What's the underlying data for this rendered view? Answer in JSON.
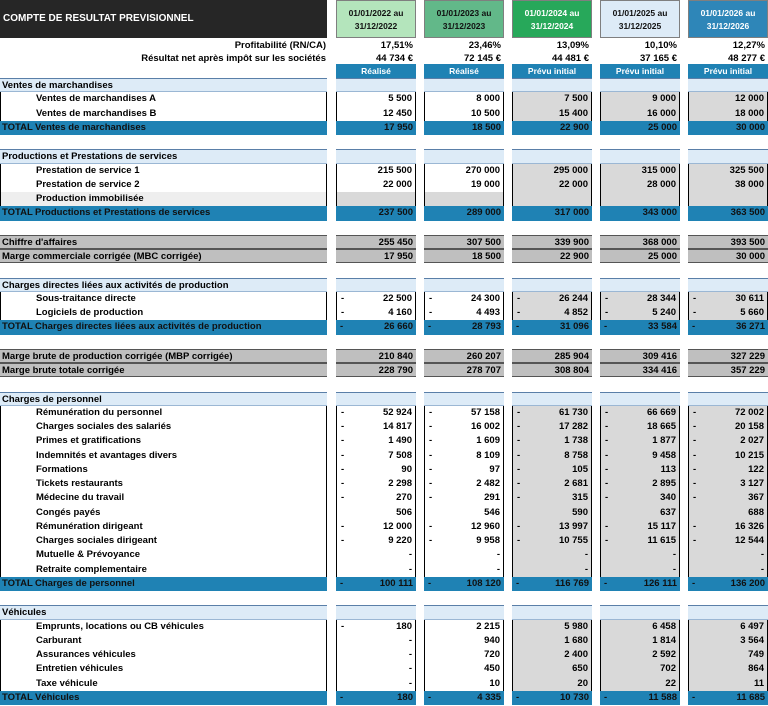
{
  "title": "COMPTE DE RESULTAT PREVISIONNEL",
  "periods": [
    {
      "line1": "01/01/2022 au",
      "line2": "31/12/2022",
      "color": "#b4e5bc",
      "status": "Réalisé"
    },
    {
      "line1": "01/01/2023 au",
      "line2": "31/12/2023",
      "color": "#62b889",
      "status": "Réalisé"
    },
    {
      "line1": "01/01/2024 au",
      "line2": "31/12/2024",
      "color": "#27a85a",
      "status": "Prévu initial"
    },
    {
      "line1": "01/01/2025 au",
      "line2": "31/12/2025",
      "color": "#ddebf7",
      "status": "Prévu initial"
    },
    {
      "line1": "01/01/2026 au",
      "line2": "31/12/2026",
      "color": "#2e86b8",
      "status": "Prévu initial"
    }
  ],
  "kpis": [
    {
      "label": "Profitabilité (RN/CA)",
      "values": [
        "17,51%",
        "23,46%",
        "13,09%",
        "10,10%",
        "12,27%"
      ]
    },
    {
      "label": "Résultat net après impôt sur les sociétés",
      "values": [
        "44 734 €",
        "72 145 €",
        "44 481 €",
        "37 165 €",
        "48 277 €"
      ]
    }
  ],
  "rows": [
    {
      "type": "section",
      "label": "Ventes de marchandises"
    },
    {
      "type": "item",
      "label": "Ventes de marchandises A",
      "values": [
        "5 500",
        "8 000",
        "7 500",
        "9 000",
        "12 000"
      ]
    },
    {
      "type": "item",
      "label": "Ventes de marchandises B",
      "values": [
        "12 450",
        "10 500",
        "15 400",
        "16 000",
        "18 000"
      ]
    },
    {
      "type": "total",
      "prefix": "TOTAL",
      "label": "Ventes de marchandises",
      "values": [
        "17 950",
        "18 500",
        "22 900",
        "25 000",
        "30 000"
      ]
    },
    {
      "type": "gap"
    },
    {
      "type": "section",
      "label": "Productions et Prestations de services"
    },
    {
      "type": "item",
      "label": "Prestation de service 1",
      "values": [
        "215 500",
        "270 000",
        "295 000",
        "315 000",
        "325 500"
      ]
    },
    {
      "type": "item",
      "label": "Prestation de service 2",
      "values": [
        "22 000",
        "19 000",
        "22 000",
        "28 000",
        "38 000"
      ]
    },
    {
      "type": "item",
      "label": "Production immobilisée",
      "values": [
        "",
        "",
        "",
        "",
        ""
      ],
      "shade": true
    },
    {
      "type": "total",
      "prefix": "TOTAL",
      "label": "Productions et Prestations de services",
      "values": [
        "237 500",
        "289 000",
        "317 000",
        "343 000",
        "363 500"
      ]
    },
    {
      "type": "gap"
    },
    {
      "type": "grey",
      "label": "Chiffre d'affaires",
      "values": [
        "255 450",
        "307 500",
        "339 900",
        "368 000",
        "393 500"
      ]
    },
    {
      "type": "grey",
      "label": "Marge commerciale corrigée (MBC corrigée)",
      "values": [
        "17 950",
        "18 500",
        "22 900",
        "25 000",
        "30 000"
      ]
    },
    {
      "type": "gap"
    },
    {
      "type": "section",
      "label": "Charges directes liées aux activités de production"
    },
    {
      "type": "item",
      "label": "Sous-traitance directe",
      "neg": true,
      "values": [
        "22 500",
        "24 300",
        "26 244",
        "28 344",
        "30 611"
      ]
    },
    {
      "type": "item",
      "label": "Logiciels de production",
      "neg": true,
      "values": [
        "4 160",
        "4 493",
        "4 852",
        "5 240",
        "5 660"
      ]
    },
    {
      "type": "total",
      "prefix": "TOTAL",
      "label": "Charges directes liées aux activités de production",
      "neg": true,
      "values": [
        "26 660",
        "28 793",
        "31 096",
        "33 584",
        "36 271"
      ]
    },
    {
      "type": "gap"
    },
    {
      "type": "grey",
      "label": "Marge brute de production corrigée (MBP corrigée)",
      "values": [
        "210 840",
        "260 207",
        "285 904",
        "309 416",
        "327 229"
      ]
    },
    {
      "type": "grey",
      "label": "Marge brute totale corrigée",
      "values": [
        "228 790",
        "278 707",
        "308 804",
        "334 416",
        "357 229"
      ]
    },
    {
      "type": "gap"
    },
    {
      "type": "section",
      "label": "Charges de personnel"
    },
    {
      "type": "item",
      "label": "Rémunération du personnel",
      "neg": true,
      "values": [
        "52 924",
        "57 158",
        "61 730",
        "66 669",
        "72 002"
      ]
    },
    {
      "type": "item",
      "label": "Charges sociales des salariés",
      "neg": true,
      "values": [
        "14 817",
        "16 002",
        "17 282",
        "18 665",
        "20 158"
      ]
    },
    {
      "type": "item",
      "label": "Primes et gratifications",
      "neg": true,
      "values": [
        "1 490",
        "1 609",
        "1 738",
        "1 877",
        "2 027"
      ]
    },
    {
      "type": "item",
      "label": "Indemnités et avantages divers",
      "neg": true,
      "values": [
        "7 508",
        "8 109",
        "8 758",
        "9 458",
        "10 215"
      ]
    },
    {
      "type": "item",
      "label": "Formations",
      "neg": true,
      "values": [
        "90",
        "97",
        "105",
        "113",
        "122"
      ]
    },
    {
      "type": "item",
      "label": "Tickets restaurants",
      "neg": true,
      "values": [
        "2 298",
        "2 482",
        "2 681",
        "2 895",
        "3 127"
      ]
    },
    {
      "type": "item",
      "label": "Médecine du travail",
      "neg": true,
      "values": [
        "270",
        "291",
        "315",
        "340",
        "367"
      ]
    },
    {
      "type": "item",
      "label": "Congés payés",
      "values": [
        "506",
        "546",
        "590",
        "637",
        "688"
      ]
    },
    {
      "type": "item",
      "label": "Rémunération dirigeant",
      "neg": true,
      "values": [
        "12 000",
        "12 960",
        "13 997",
        "15 117",
        "16 326"
      ]
    },
    {
      "type": "item",
      "label": "Charges sociales dirigeant",
      "neg": true,
      "values": [
        "9 220",
        "9 958",
        "10 755",
        "11 615",
        "12 544"
      ]
    },
    {
      "type": "item",
      "label": "Mutuelle & Prévoyance",
      "values": [
        "-",
        "-",
        "-",
        "-",
        "-"
      ]
    },
    {
      "type": "item",
      "label": "Retraite complementaire",
      "values": [
        "-",
        "-",
        "-",
        "-",
        "-"
      ]
    },
    {
      "type": "total",
      "prefix": "TOTAL",
      "label": "Charges de personnel",
      "neg": true,
      "values": [
        "100 111",
        "108 120",
        "116 769",
        "126 111",
        "136 200"
      ]
    },
    {
      "type": "gap"
    },
    {
      "type": "section",
      "label": "Véhicules"
    },
    {
      "type": "item",
      "label": "Emprunts, locations ou CB véhicules",
      "negFirst": true,
      "values": [
        "180",
        "2 215",
        "5 980",
        "6 458",
        "6 497"
      ]
    },
    {
      "type": "item",
      "label": "Carburant",
      "values": [
        "-",
        "940",
        "1 680",
        "1 814",
        "3 564"
      ]
    },
    {
      "type": "item",
      "label": "Assurances véhicules",
      "values": [
        "-",
        "720",
        "2 400",
        "2 592",
        "749"
      ]
    },
    {
      "type": "item",
      "label": "Entretien véhicules",
      "values": [
        "-",
        "450",
        "650",
        "702",
        "864"
      ]
    },
    {
      "type": "item",
      "label": "Taxe véhicule",
      "values": [
        "-",
        "10",
        "20",
        "22",
        "11"
      ]
    },
    {
      "type": "total",
      "prefix": "TOTAL",
      "label": "Véhicules",
      "neg": true,
      "values": [
        "180",
        "4 335",
        "10 730",
        "11 588",
        "11 685"
      ]
    }
  ]
}
